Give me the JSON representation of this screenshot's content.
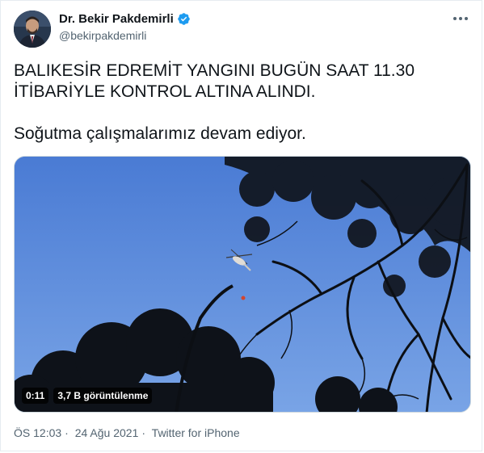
{
  "author": {
    "name": "Dr. Bekir Pakdemirli",
    "handle": "@bekirpakdemirli",
    "verified": true
  },
  "tweet": {
    "line1": "BALIKESİR EDREMİT YANGINI BUGÜN SAAT 11.30",
    "line2": "İTİBARİYLE KONTROL ALTINA ALINDI.",
    "line3": "Soğutma çalışmalarımız devam ediyor."
  },
  "video": {
    "duration": "0:11",
    "views": "3,7 B görüntülenme"
  },
  "meta": {
    "time": "ÖS 12:03",
    "separator": "·",
    "date": "24 Ağu 2021",
    "source": "Twitter for iPhone"
  },
  "icons": {
    "more": "more-horizontal-icon",
    "verified": "verified-badge-icon"
  },
  "colors": {
    "accent": "#1d9bf0",
    "text": "#0f1419",
    "muted": "#536471",
    "sky": "#5b8ee0"
  }
}
